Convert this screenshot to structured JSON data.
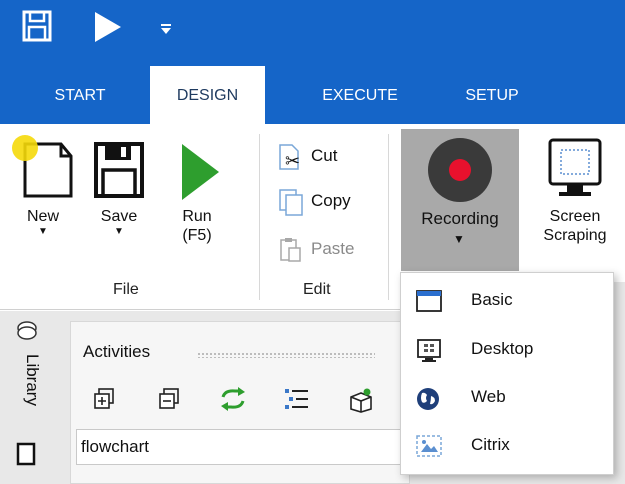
{
  "tabs": [
    "START",
    "DESIGN",
    "EXECUTE",
    "SETUP"
  ],
  "file_group": {
    "label": "File",
    "new": "New",
    "save": "Save",
    "run": "Run",
    "run_shortcut": "(F5)"
  },
  "edit_group": {
    "label": "Edit",
    "cut": "Cut",
    "copy": "Copy",
    "paste": "Paste"
  },
  "recording": {
    "label": "Recording"
  },
  "screen_scraping": {
    "line1": "Screen",
    "line2": "Scraping"
  },
  "sidebar": {
    "library_tab": "Library"
  },
  "activities_panel": {
    "title": "Activities",
    "search_value": "flowchart"
  },
  "recording_menu": [
    "Basic",
    "Desktop",
    "Web",
    "Citrix"
  ],
  "colors": {
    "titlebar": "#1565c8",
    "record_red": "#e8112d",
    "run_green": "#2e9e2e"
  }
}
